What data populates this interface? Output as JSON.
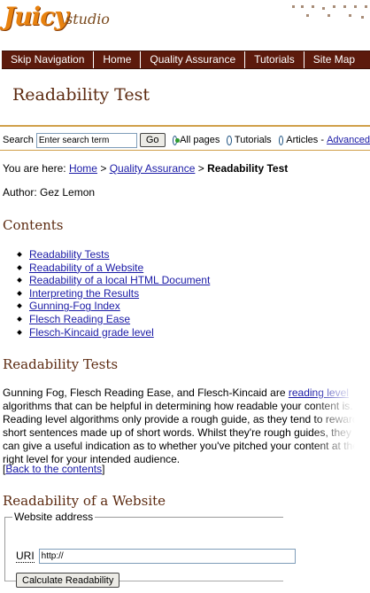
{
  "logo": {
    "text_main": "Juicy",
    "text_sub": "studio"
  },
  "nav": {
    "items": [
      "Skip Navigation",
      "Home",
      "Quality Assurance",
      "Tutorials",
      "Site Map"
    ]
  },
  "page": {
    "title": "Readability Test"
  },
  "search": {
    "label": "Search",
    "input_value": "Enter search term",
    "go_label": "Go",
    "options": [
      "All pages",
      "Tutorials",
      "Articles"
    ],
    "selected_option": "All pages",
    "advanced_label": "Advanced"
  },
  "breadcrumb": {
    "prefix": "You are here:",
    "home": "Home",
    "qa": "Quality Assurance",
    "current": "Readability Test",
    "sep": ">"
  },
  "author": "Author: Gez Lemon",
  "contents": {
    "heading": "Contents",
    "items": [
      "Readability Tests",
      "Readability of a Website",
      "Readability of a local HTML Document",
      "Interpreting the Results",
      "Gunning-Fog Index",
      "Flesch Reading Ease",
      "Flesch-Kincaid grade level"
    ]
  },
  "section1": {
    "heading": "Readability Tests",
    "text_before_link": "Gunning Fog, Flesch Reading Ease, and Flesch-Kincaid are ",
    "link_text": "reading level",
    "text_after_link": " algorithms that can be helpful in determining how readable your content is. Reading level algorithms only provide a rough guide, as they tend to reward short sentences made up of short words. Whilst they're rough guides, they can give a useful indication as to whether you've pitched your content at the right level for your intended audience.",
    "back_open": "[",
    "back_link": "Back to the contents",
    "back_close": "]"
  },
  "section2": {
    "heading": "Readability of a Website",
    "legend": "Website address",
    "uri_label": "URI",
    "uri_value": "http://",
    "button_label": "Calculate Readability"
  }
}
